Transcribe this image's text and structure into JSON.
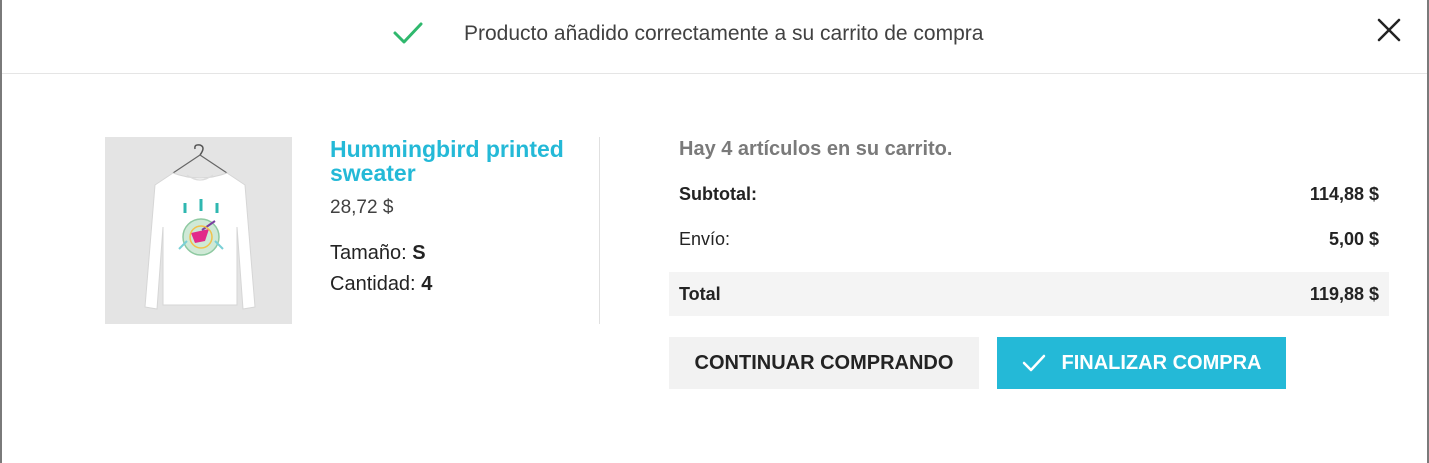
{
  "header": {
    "message": "Producto añadido correctamente a su carrito de compra",
    "check_icon": "check-icon",
    "close_icon": "close-icon"
  },
  "product": {
    "name": "Hummingbird printed sweater",
    "price": "28,72 $",
    "size_label": "Tamaño:",
    "size_value": "S",
    "quantity_label": "Cantidad:",
    "quantity_value": "4"
  },
  "cart": {
    "count_text": "Hay 4 artículos en su carrito.",
    "subtotal_label": "Subtotal:",
    "subtotal_value": "114,88 $",
    "shipping_label": "Envío:",
    "shipping_value": "5,00 $",
    "total_label": "Total",
    "total_value": "119,88 $"
  },
  "actions": {
    "continue_label": "CONTINUAR COMPRANDO",
    "checkout_label": "FINALIZAR COMPRA"
  },
  "colors": {
    "accent": "#24b9d7",
    "success": "#2fb86d",
    "button_gray": "#f2f2f2",
    "total_row_bg": "#f4f4f4"
  }
}
